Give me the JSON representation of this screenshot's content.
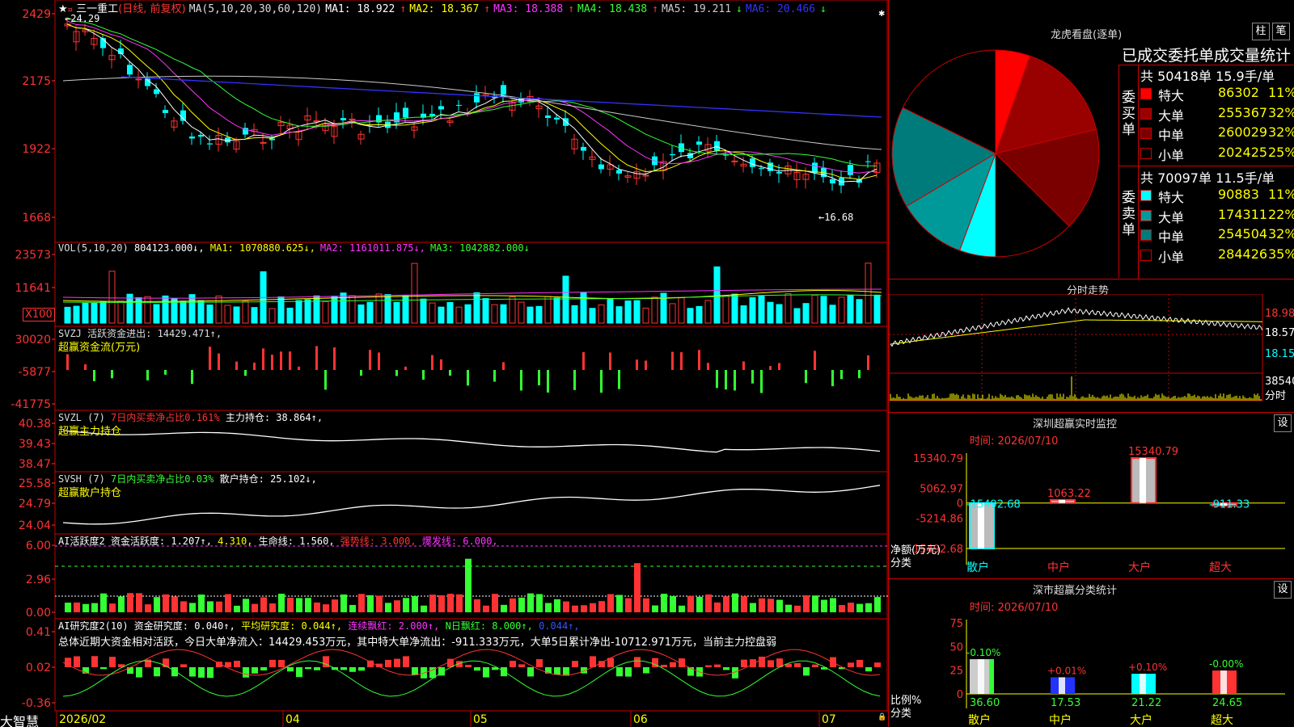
{
  "app": {
    "stock_name": "三一重工",
    "stock_mode": "(日线, 前复权)",
    "footer_brand": "大智慧"
  },
  "main_chart": {
    "ma_label": "MA(5,10,20,30,60,120)",
    "ma_values": [
      {
        "label": "MA1: 18.922",
        "arrow": "↑",
        "color": "#ffffff"
      },
      {
        "label": "MA2: 18.367",
        "arrow": "↑",
        "color": "#ffff00"
      },
      {
        "label": "MA3: 18.388",
        "arrow": "↑",
        "color": "#ff33ff"
      },
      {
        "label": "MA4: 18.438",
        "arrow": "↑",
        "color": "#33ff33"
      },
      {
        "label": "MA5: 19.211",
        "arrow": "↓",
        "color": "#cccccc"
      },
      {
        "label": "MA6: 20.466",
        "arrow": "↓",
        "color": "#3333ff"
      }
    ],
    "y_ticks": [
      "2429",
      "2175",
      "1922",
      "1668"
    ],
    "high_note": "24.29",
    "low_note": "←16.68",
    "x_labels": [
      "2026/02",
      "04",
      "05",
      "06",
      "07"
    ]
  },
  "volume": {
    "header": "VOL(5,10,20)",
    "header_value": "804123.000↓,",
    "ma_values": [
      {
        "label": "MA1: 1070880.625↓,",
        "color": "#ffff00"
      },
      {
        "label": "MA2: 1161011.875↓,",
        "color": "#ff33ff"
      },
      {
        "label": "MA3: 1042882.000↓",
        "color": "#33ff33"
      }
    ],
    "y_ticks": [
      "23573",
      "11641"
    ],
    "unit": "X100"
  },
  "svzj": {
    "header": "SVZJ  活跃资金进出: 14429.471↑,",
    "subtitle": "超赢资金流(万元)",
    "y_ticks": [
      "30020",
      "-5877",
      "-41775"
    ]
  },
  "svzl": {
    "header_left": "SVZL (7)",
    "header_red": "7日内买卖净占比0.161%",
    "header_right": "主力持仓: 38.864↑,",
    "subtitle": "超赢主力持仓",
    "y_ticks": [
      "40.38",
      "39.43",
      "38.47"
    ]
  },
  "svsh": {
    "header_left": "SVSH (7)",
    "header_green": "7日内买卖净占比0.03%",
    "header_right": "散户持仓: 25.102↓,",
    "subtitle": "超赢散户持仓",
    "y_ticks": [
      "25.58",
      "24.79",
      "24.04"
    ]
  },
  "ai_active": {
    "header_a": "AI活跃度2 资金活跃度: 1.207↑,",
    "header_b": "4.310,",
    "header_c": "生命线: 1.560,",
    "header_d": "强势线: 3.000,",
    "header_e": "爆发线: 6.000,",
    "y_ticks": [
      "6.00",
      "2.96",
      "0.00"
    ]
  },
  "ai_research": {
    "header_a": "AI研究度2(10) 资金研究度: 0.040↑,",
    "header_b": "平均研究度: 0.044↑,",
    "header_c": "连续飘红: 2.000↑,",
    "header_d": "N日飘红: 8.000↑,",
    "header_e": "0.044↑,",
    "summary": "总体近期大资金相对活跃，今日大单净流入：14429.453万元，其中特大单净流出：-911.333万元，大单5日累计净出-10712.971万元，当前主力控盘弱",
    "y_ticks": [
      "0.41",
      "0.02",
      "-0.36"
    ]
  },
  "dragon_tiger": {
    "title": "龙虎看盘(逐单)",
    "btn_bar": "柱",
    "btn_pen": "笔",
    "stats_title": "已成交委托单成交量统计",
    "buy_label": "委买单",
    "sell_label": "委卖单",
    "buy_header": "共 50418单 15.9手/单",
    "sell_header": "共 70097单 11.5手/单",
    "buy_rows": [
      {
        "name": "特大",
        "value": "86302",
        "pct": "11%",
        "color": "#ff0000"
      },
      {
        "name": "大单",
        "value": "255367",
        "pct": "32%",
        "color": "#990000"
      },
      {
        "name": "中单",
        "value": "260029",
        "pct": "32%",
        "color": "#7a0000"
      },
      {
        "name": "小单",
        "value": "202425",
        "pct": "25%",
        "color": "#000000"
      }
    ],
    "sell_rows": [
      {
        "name": "特大",
        "value": "90883",
        "pct": "11%",
        "color": "#00ffff"
      },
      {
        "name": "大单",
        "value": "174311",
        "pct": "22%",
        "color": "#009999"
      },
      {
        "name": "中单",
        "value": "254504",
        "pct": "32%",
        "color": "#007b7b"
      },
      {
        "name": "小单",
        "value": "284426",
        "pct": "35%",
        "color": "#000000"
      }
    ]
  },
  "intraday": {
    "title": "分时走势",
    "y_ticks": [
      "18.98",
      "18.57",
      "18.15"
    ],
    "vol_tick": "38540",
    "vol_label": "分时"
  },
  "sz_monitor": {
    "title": "深圳超赢实时监控",
    "btn": "设",
    "time": "时间: 2026/07/10",
    "y_ticks": [
      "15340.79",
      "5062.97",
      "0",
      "-5214.86",
      "-15492.68"
    ],
    "y_label": "净额(万元)",
    "x_label": "分类",
    "bars": [
      {
        "name": "散户",
        "value": -15492.68,
        "label": "-15492.68",
        "name_color": "#00ffff"
      },
      {
        "name": "中户",
        "value": 1063.22,
        "label": "1063.22",
        "name_color": "#ff3333"
      },
      {
        "name": "大户",
        "value": 15340.79,
        "label": "15340.79",
        "name_color": "#ff3333"
      },
      {
        "name": "超大",
        "value": -911.33,
        "label": "-911.33",
        "name_color": "#ff3333"
      }
    ]
  },
  "sz_class": {
    "title": "深市超赢分类统计",
    "btn": "设",
    "time": "时间: 2026/07/10",
    "y_ticks": [
      "75",
      "50",
      "25",
      "0"
    ],
    "y_label": "比例%",
    "x_label": "分类",
    "bars": [
      {
        "name": "散户",
        "value": 36.6,
        "label": "36.60",
        "delta": "-0.10%",
        "color": "#cccccc",
        "accent": "#33ff33",
        "name_color": "#ffff00"
      },
      {
        "name": "中户",
        "value": 17.53,
        "label": "17.53",
        "delta": "+0.01%",
        "color": "#2233ff",
        "accent": "#2233ff",
        "name_color": "#ffff00"
      },
      {
        "name": "大户",
        "value": 21.22,
        "label": "21.22",
        "delta": "+0.10%",
        "color": "#00ffff",
        "accent": "#00ffff",
        "name_color": "#ffff00"
      },
      {
        "name": "超大",
        "value": 24.65,
        "label": "24.65",
        "delta": "-0.00%",
        "color": "#ff3333",
        "accent": "#ff3333",
        "name_color": "#ffff00"
      }
    ]
  },
  "chart_data": [
    {
      "type": "pie",
      "title": "龙虎看盘(逐单)",
      "categories": [
        "委买特大",
        "委买大单",
        "委买中单",
        "委买小单",
        "委卖特大",
        "委卖大单",
        "委卖中单",
        "委卖小单"
      ],
      "values": [
        86302,
        255367,
        260029,
        202425,
        90883,
        174311,
        254504,
        284426
      ],
      "colors": [
        "#ff0000",
        "#990000",
        "#7a0000",
        "#000000",
        "#00ffff",
        "#009999",
        "#007b7b",
        "#000000"
      ]
    },
    {
      "type": "bar",
      "title": "深圳超赢实时监控",
      "categories": [
        "散户",
        "中户",
        "大户",
        "超大"
      ],
      "values": [
        -15492.68,
        1063.22,
        15340.79,
        -911.33
      ],
      "ylabel": "净额(万元)",
      "xlabel": "分类",
      "ylim": [
        -15492.68,
        15340.79
      ]
    },
    {
      "type": "bar",
      "title": "深市超赢分类统计",
      "categories": [
        "散户",
        "中户",
        "大户",
        "超大"
      ],
      "values": [
        36.6,
        17.53,
        21.22,
        24.65
      ],
      "ylabel": "比例%",
      "xlabel": "分类",
      "ylim": [
        0,
        75
      ]
    }
  ]
}
